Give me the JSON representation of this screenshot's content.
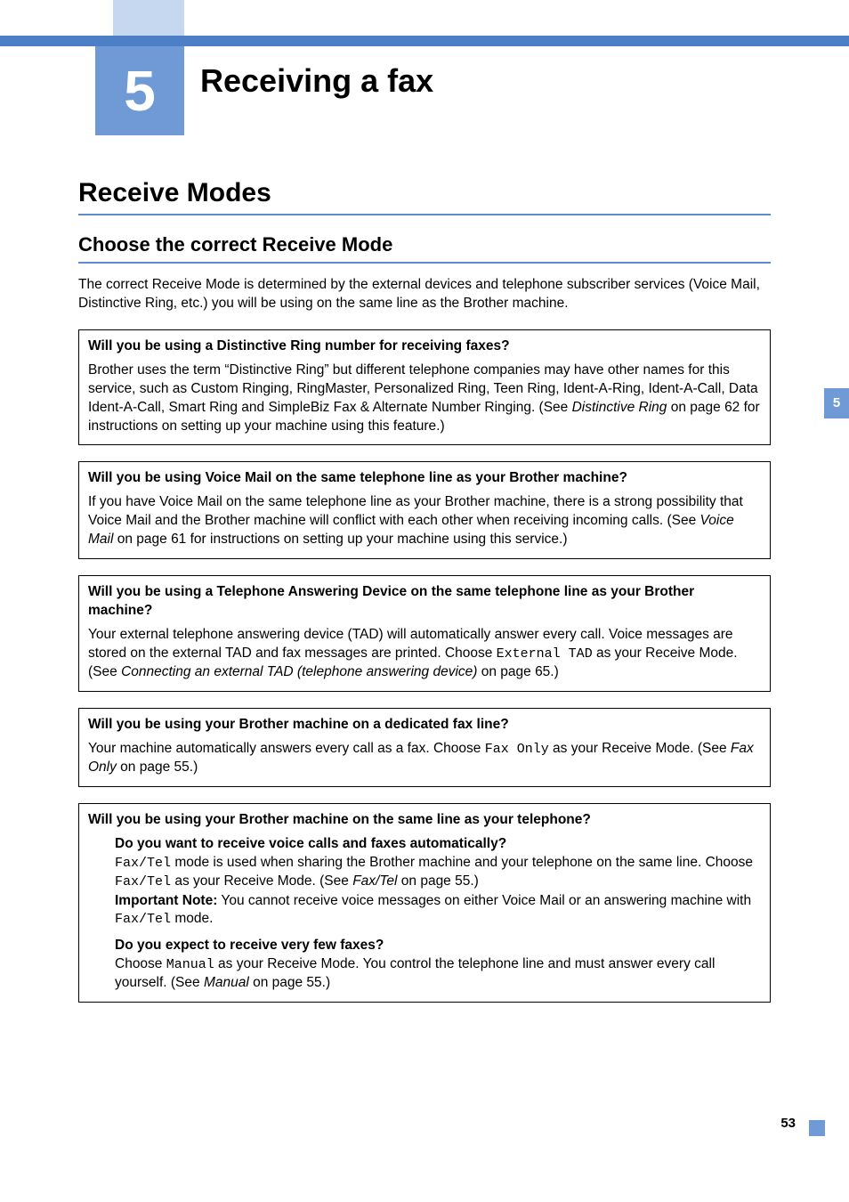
{
  "chapter": {
    "number": "5",
    "title": "Receiving a fax"
  },
  "sideTab": "5",
  "pageNumber": "53",
  "section": {
    "heading": "Receive Modes",
    "sub": "Choose the correct Receive Mode",
    "intro": "The correct Receive Mode is determined by the external devices and telephone subscriber services (Voice Mail, Distinctive Ring, etc.) you will be using on the same line as the Brother machine."
  },
  "box1": {
    "q": "Will you be using a Distinctive Ring number for receiving faxes?",
    "body_a": "Brother uses the term “Distinctive Ring” but different telephone companies may have other names for this service, such as Custom Ringing, RingMaster, Personalized Ring, Teen Ring, Ident-A-Ring, Ident-A-Call, Data Ident-A-Call, Smart Ring and SimpleBiz Fax & Alternate Number Ringing. (See ",
    "link": "Distinctive Ring",
    "body_b": " on page 62 for instructions on setting up your machine using this feature.)"
  },
  "box2": {
    "q": "Will you be using Voice Mail on the same telephone line as your Brother machine?",
    "body_a": "If you have Voice Mail on the same telephone line as your Brother machine, there is a strong possibility that Voice Mail and the Brother machine will conflict with each other when receiving incoming calls. (See ",
    "link": "Voice Mail",
    "body_b": " on page 61 for instructions on setting up your machine using this service.)"
  },
  "box3": {
    "q": "Will you be using a Telephone Answering Device on the same telephone line as your Brother machine?",
    "body_a": "Your external telephone answering device (TAD) will automatically answer every call. Voice messages are stored on the external TAD and fax messages are printed. Choose ",
    "code": "External TAD",
    "body_b": " as your Receive Mode. (See ",
    "link": "Connecting an external TAD (telephone answering device)",
    "body_c": " on page 65.)"
  },
  "box4": {
    "q": "Will you be using your Brother machine on a dedicated fax line?",
    "body_a": "Your machine automatically answers every call as a fax. Choose ",
    "code": "Fax Only",
    "body_b": " as your Receive Mode. (See ",
    "link": "Fax Only",
    "body_c": " on page 55.)"
  },
  "box5": {
    "q": "Will you be using your Brother machine on the same line as your telephone?",
    "sub1": {
      "q": "Do you want to receive voice calls and faxes automatically?",
      "code1": "Fax/Tel",
      "t1": " mode is used when sharing the Brother machine and your telephone on the same line. Choose ",
      "code2": "Fax/Tel",
      "t2": " as your Receive Mode. (See ",
      "link": "Fax/Tel",
      "t3": " on page 55.)",
      "noteLabel": "Important Note:",
      "noteBody": " You cannot receive voice messages on either Voice Mail or an answering machine with ",
      "code3": "Fax/Tel",
      "noteTail": " mode."
    },
    "sub2": {
      "q": "Do you expect to receive very few faxes?",
      "t1": "Choose ",
      "code": "Manual",
      "t2": " as your Receive Mode. You control the telephone line and must answer every call yourself. (See ",
      "link": "Manual",
      "t3": " on page 55.)"
    }
  }
}
